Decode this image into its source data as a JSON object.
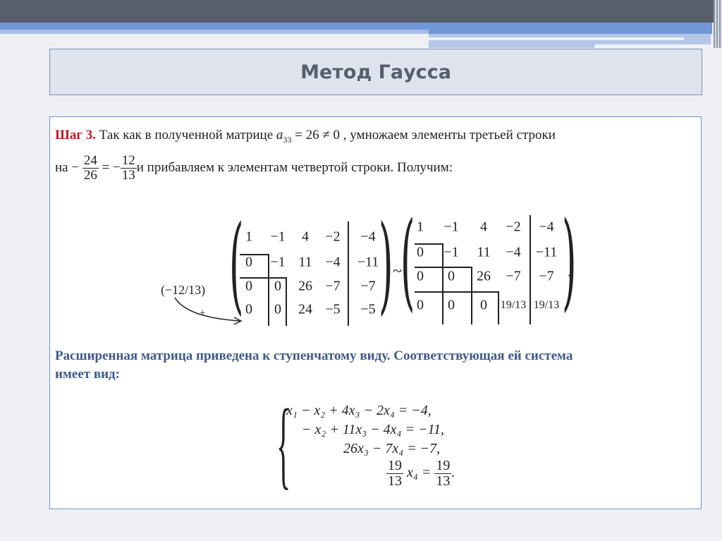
{
  "title": "Метод Гаусса",
  "step": {
    "label": "Шаг 3.",
    "line1_a": "Так как  в полученной матрице ",
    "a33": "a",
    "a33_sub": "33",
    "line1_b": " = 26 ≠ 0 , умножаем элементы третьей строки",
    "line2_a": "на −",
    "f1n": "24",
    "f1d": "26",
    "eq": " = −",
    "f2n": "12",
    "f2d": "13",
    "line2_b": "и прибавляем к элементам четвертой строки. Получим:"
  },
  "multiplier": "(−12/13)",
  "plus": "+",
  "tilde": "~",
  "dot": ".",
  "matrix_left": [
    [
      "1",
      "−1",
      "4",
      "−2",
      "−4"
    ],
    [
      "0",
      "−1",
      "11",
      "−4",
      "−11"
    ],
    [
      "0",
      "0",
      "26",
      "−7",
      "−7"
    ],
    [
      "0",
      "0",
      "24",
      "−5",
      "−5"
    ]
  ],
  "matrix_right": [
    [
      "1",
      "−1",
      "4",
      "−2",
      "−4"
    ],
    [
      "0",
      "−1",
      "11",
      "−4",
      "−11"
    ],
    [
      "0",
      "0",
      "26",
      "−7",
      "−7"
    ],
    [
      "0",
      "0",
      "0",
      "19/13",
      "19/13"
    ]
  ],
  "conclusion": {
    "line1": "Расширенная матрица приведена к ступенчатому виду. Соответствующая ей система",
    "line2": "имеет вид:"
  },
  "system": [
    "x₁ − x₂ + 4x₃ − 2x₄ = −4,",
    "− x₂ + 11x₃ − 4x₄ = −11,",
    "26x₃ − 7x₄ = −7,"
  ],
  "system_last": {
    "n": "19",
    "d": "13",
    "mid": "x₄ =",
    "n2": "19",
    "d2": "13",
    "end": "."
  }
}
